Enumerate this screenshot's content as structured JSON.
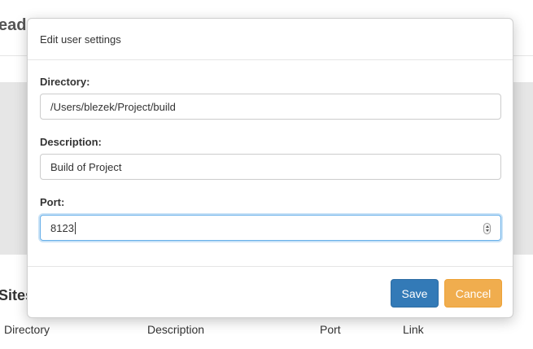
{
  "background": {
    "heading": "ead",
    "sites_heading": "Sites",
    "columns": [
      "Directory",
      "Description",
      "Port",
      "Link"
    ]
  },
  "modal": {
    "title": "Edit user settings",
    "fields": [
      {
        "label": "Directory:",
        "value": "/Users/blezek/Project/build"
      },
      {
        "label": "Description:",
        "value": "Build of Project"
      },
      {
        "label": "Port:",
        "value": "8123"
      }
    ],
    "save_label": "Save",
    "cancel_label": "Cancel"
  },
  "colors": {
    "save": "#337ab7",
    "cancel": "#f0ad4e",
    "focus": "#66afe9"
  }
}
